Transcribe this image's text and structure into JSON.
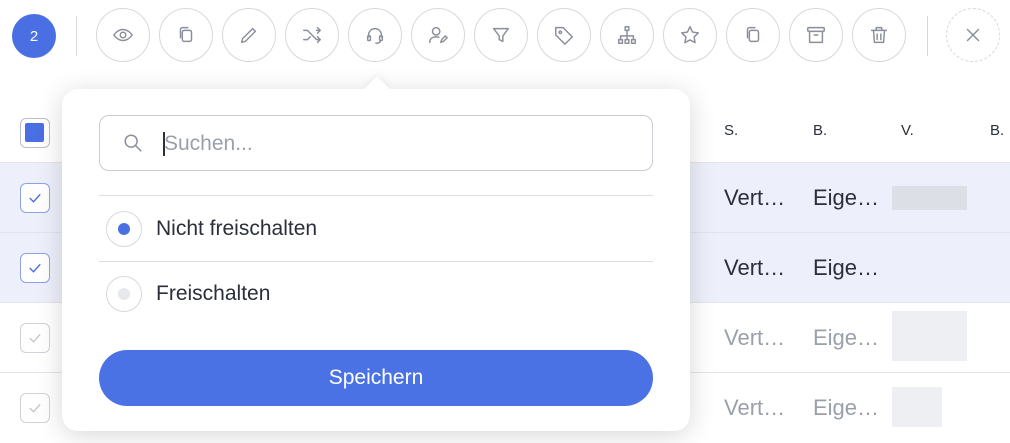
{
  "toolbar": {
    "selected_count": "2",
    "buttons": [
      {
        "name": "view",
        "icon": "eye-icon"
      },
      {
        "name": "copy",
        "icon": "copy-icon"
      },
      {
        "name": "edit",
        "icon": "pencil-icon"
      },
      {
        "name": "shuffle",
        "icon": "shuffle-icon"
      },
      {
        "name": "support",
        "icon": "headset-icon"
      },
      {
        "name": "assign-user",
        "icon": "user-edit-icon"
      },
      {
        "name": "filter",
        "icon": "filter-icon"
      },
      {
        "name": "tag",
        "icon": "tag-icon"
      },
      {
        "name": "hierarchy",
        "icon": "hierarchy-icon"
      },
      {
        "name": "favorite",
        "icon": "star-icon"
      },
      {
        "name": "duplicate",
        "icon": "copy-icon"
      },
      {
        "name": "archive",
        "icon": "archive-icon"
      },
      {
        "name": "delete",
        "icon": "trash-icon"
      }
    ],
    "close_icon": "close-icon"
  },
  "table": {
    "headers": [
      "S.",
      "B.",
      "V.",
      "B."
    ],
    "rows": [
      {
        "selected": true,
        "cells": [
          "Vert…",
          "Eige…"
        ]
      },
      {
        "selected": true,
        "cells": [
          "Vert…",
          "Eige…"
        ]
      },
      {
        "selected": false,
        "cells": [
          "Vert…",
          "Eige…"
        ]
      },
      {
        "selected": false,
        "cells": [
          "Vert…",
          "Eige…"
        ]
      }
    ]
  },
  "popover": {
    "search_placeholder": "Suchen...",
    "options": [
      {
        "label": "Nicht freischalten",
        "selected": true
      },
      {
        "label": "Freischalten",
        "selected": false
      }
    ],
    "save_label": "Speichern"
  },
  "colors": {
    "accent": "#4a6fe3",
    "selected_row": "#edf0fb"
  }
}
